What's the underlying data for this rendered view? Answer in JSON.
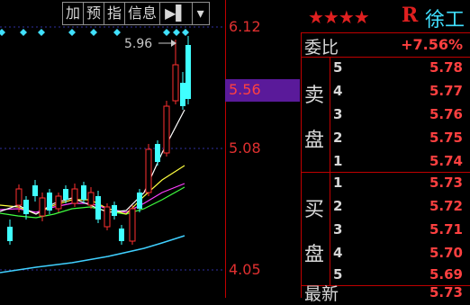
{
  "toolbar": {
    "add_label": "加",
    "warn_label": "预",
    "index_label": "指",
    "info_label": "信息",
    "expand_icon": "▶▌",
    "menu_icon": "▾"
  },
  "axis": {
    "ticks": [
      "6.12",
      "5.08",
      "4.05"
    ],
    "current_price": "5.56"
  },
  "chart": {
    "max_label": "5.96",
    "colors": {
      "up": "#ff3030",
      "ma5": "#ffffff",
      "ma10": "#ffff40",
      "ma20": "#ff40ff",
      "ma30": "#40ff40",
      "ma60": "#40d0ff",
      "grid": "#4040c0"
    }
  },
  "header": {
    "stars": "★★★★",
    "r_mark": "R",
    "stock_name": "徐工"
  },
  "weibi": {
    "label": "委比",
    "value": "+7.56%"
  },
  "sell": {
    "label_top": "卖",
    "label_bottom": "盘",
    "levels": [
      {
        "n": "5",
        "price": "5.78"
      },
      {
        "n": "4",
        "price": "5.77"
      },
      {
        "n": "3",
        "price": "5.76"
      },
      {
        "n": "2",
        "price": "5.75"
      },
      {
        "n": "1",
        "price": "5.74"
      }
    ]
  },
  "buy": {
    "label_top": "买",
    "label_bottom": "盘",
    "levels": [
      {
        "n": "1",
        "price": "5.73"
      },
      {
        "n": "2",
        "price": "5.72"
      },
      {
        "n": "3",
        "price": "5.71"
      },
      {
        "n": "4",
        "price": "5.70"
      },
      {
        "n": "5",
        "price": "5.69"
      }
    ]
  },
  "last": {
    "label": "最新",
    "value": "5.73"
  }
}
